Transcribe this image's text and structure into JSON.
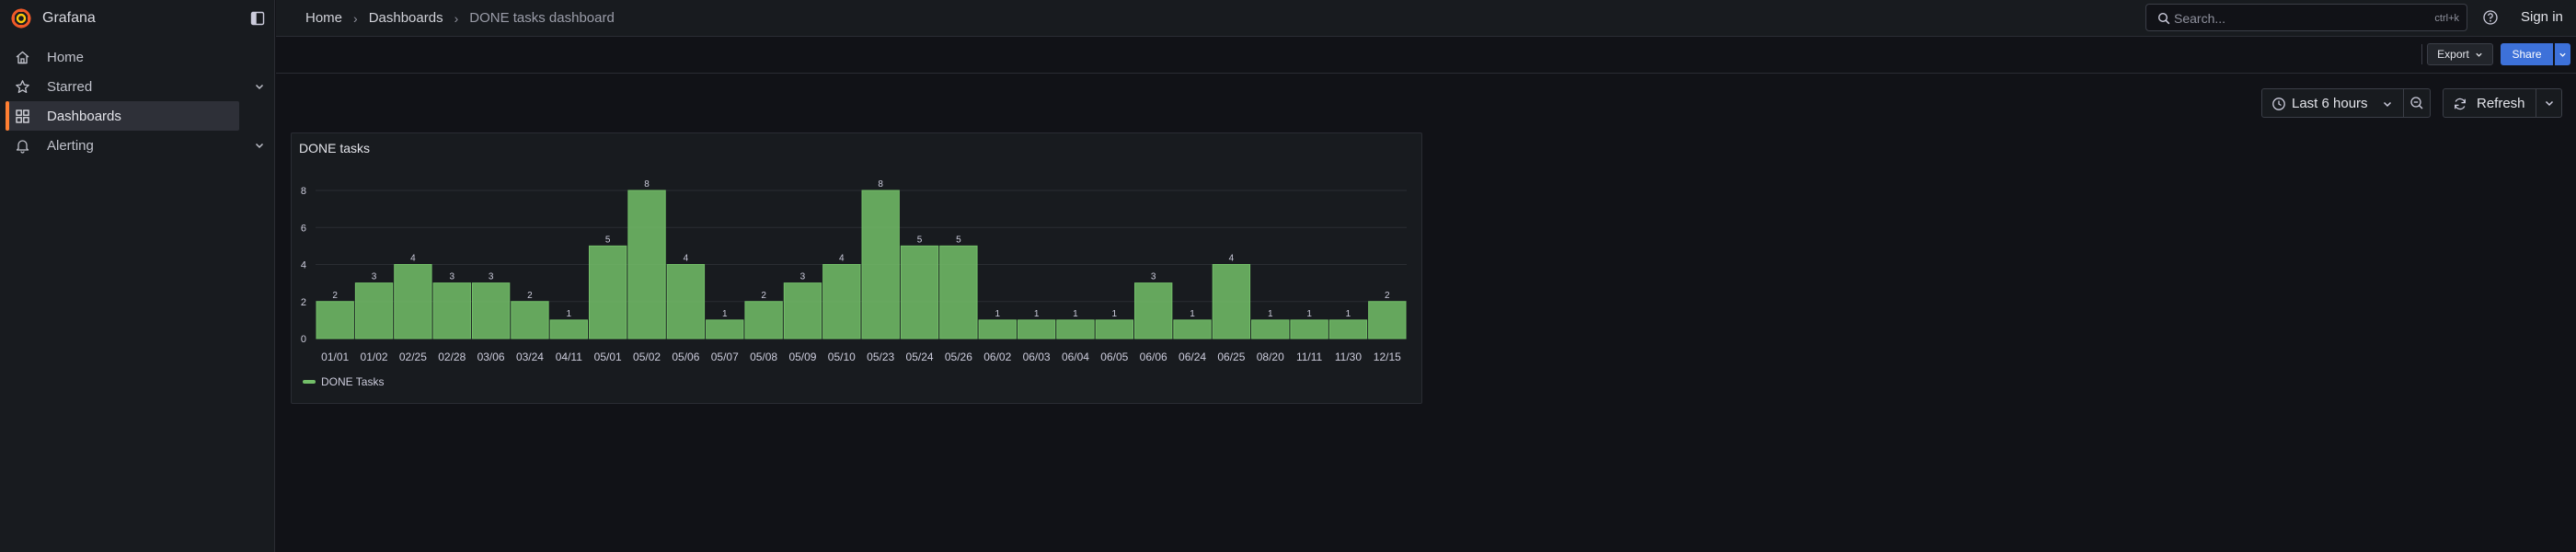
{
  "app": {
    "name": "Grafana"
  },
  "colors": {
    "accent": "#ff7f32",
    "bar": "#73bf69",
    "primary": "#3d71d9"
  },
  "sidebar": {
    "items": [
      {
        "label": "Home",
        "icon": "home-icon",
        "active": false,
        "expandable": false
      },
      {
        "label": "Starred",
        "icon": "star-icon",
        "active": false,
        "expandable": true
      },
      {
        "label": "Dashboards",
        "icon": "apps-icon",
        "active": true,
        "expandable": false
      },
      {
        "label": "Alerting",
        "icon": "bell-icon",
        "active": false,
        "expandable": true
      }
    ]
  },
  "breadcrumb": [
    "Home",
    "Dashboards",
    "DONE tasks dashboard"
  ],
  "search": {
    "placeholder": "Search...",
    "shortcut": "ctrl+k"
  },
  "header": {
    "signin_label": "Sign in"
  },
  "toolbar": {
    "export_label": "Export",
    "share_label": "Share",
    "time_range": "Last 6 hours",
    "refresh_label": "Refresh"
  },
  "panel": {
    "title": "DONE tasks"
  },
  "chart_data": {
    "type": "bar",
    "title": "DONE tasks",
    "categories": [
      "01/01",
      "01/02",
      "02/25",
      "02/28",
      "03/06",
      "03/24",
      "04/11",
      "05/01",
      "05/02",
      "05/06",
      "05/07",
      "05/08",
      "05/09",
      "05/10",
      "05/23",
      "05/24",
      "05/26",
      "06/02",
      "06/03",
      "06/04",
      "06/05",
      "06/06",
      "06/24",
      "06/25",
      "08/20",
      "11/11",
      "11/30",
      "12/15"
    ],
    "series": [
      {
        "name": "DONE Tasks",
        "values": [
          2,
          3,
          4,
          3,
          3,
          2,
          1,
          5,
          8,
          4,
          1,
          2,
          3,
          4,
          8,
          5,
          5,
          1,
          1,
          1,
          1,
          3,
          1,
          4,
          1,
          1,
          1,
          2
        ]
      }
    ],
    "yticks": [
      0,
      2,
      4,
      6,
      8
    ],
    "ylim": [
      0,
      8
    ],
    "grid": true,
    "legend": "bottom-left"
  }
}
